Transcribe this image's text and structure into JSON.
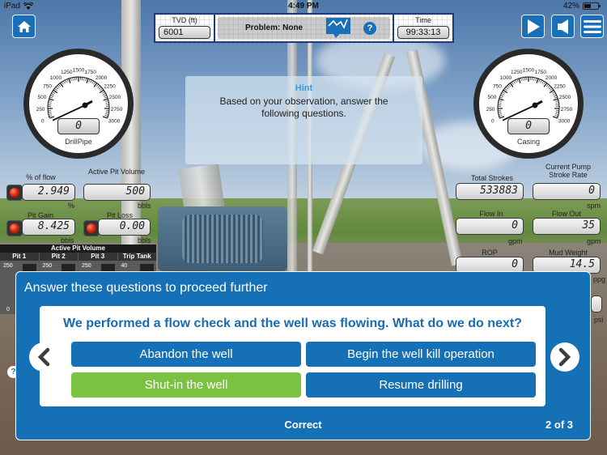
{
  "status_bar": {
    "device": "iPad",
    "time": "4:49 PM",
    "battery": "42%"
  },
  "toolbar": {
    "home_icon": "home-icon",
    "play_icon": "play-icon",
    "sound_icon": "speaker-icon",
    "menu_icon": "hamburger-menu-icon"
  },
  "top_panel": {
    "tvd_label": "TVD (ft)",
    "tvd_value": "6001",
    "problem_text": "Problem: None",
    "chart_icon": "chart-icon",
    "help_label": "?",
    "time_label": "Time",
    "time_value": "99:33:13"
  },
  "gauges": {
    "drillpipe": {
      "name": "DrillPipe",
      "value": "0",
      "scale_labels": [
        "0",
        "250",
        "500",
        "750",
        "1000",
        "1250",
        "1500",
        "1750",
        "2000",
        "2250",
        "2500",
        "2750",
        "3000"
      ]
    },
    "casing": {
      "name": "Casing",
      "value": "0",
      "scale_labels": [
        "0",
        "250",
        "500",
        "750",
        "1000",
        "1250",
        "1500",
        "1750",
        "2000",
        "2250",
        "2500",
        "2750",
        "3000"
      ]
    }
  },
  "hint": {
    "title": "Hint",
    "body": "Based on your observation, answer the following questions."
  },
  "left_readouts": {
    "pct_flow": {
      "label": "% of flow",
      "value": "2.949",
      "unit": "%"
    },
    "active_pit_volume": {
      "label": "Active Pit Volume",
      "value": "500",
      "unit": "bbls"
    },
    "pit_gain": {
      "label": "Pit Gain",
      "value": "8.425",
      "unit": "bbls"
    },
    "pit_loss": {
      "label": "Pit Loss",
      "value": "0.00",
      "unit": "bbls"
    }
  },
  "right_readouts": {
    "total_strokes": {
      "label": "Total Strokes",
      "value": "533883",
      "unit": ""
    },
    "pump_stroke_rate": {
      "label": "Current Pump Stroke Rate",
      "value": "0",
      "unit": "spm"
    },
    "flow_in": {
      "label": "Flow In",
      "value": "0",
      "unit": "gpm"
    },
    "flow_out": {
      "label": "Flow Out",
      "value": "35",
      "unit": "gpm"
    },
    "rop": {
      "label": "ROP",
      "value": "0",
      "unit": ""
    },
    "mud_weight": {
      "label": "Mud Weight",
      "value": "14.5",
      "unit": "ppg"
    },
    "extra_unit": "psi"
  },
  "pit_volume_panel": {
    "title": "Active Pit Volume",
    "pits": [
      {
        "name": "Pit 1",
        "max": "250",
        "min": "0"
      },
      {
        "name": "Pit 2",
        "max": "250",
        "min": ""
      },
      {
        "name": "Pit 3",
        "max": "250",
        "min": ""
      },
      {
        "name": "Trip Tank",
        "max": "40",
        "min": ""
      }
    ]
  },
  "quiz": {
    "title": "Answer these questions to proceed further",
    "question": "We performed a flow check and the well was flowing. What do we do next?",
    "answers": [
      {
        "label": "Abandon the well",
        "state": "default"
      },
      {
        "label": "Begin the well kill operation",
        "state": "default"
      },
      {
        "label": "Shut-in the well",
        "state": "correct"
      },
      {
        "label": "Resume drilling",
        "state": "default"
      }
    ],
    "status": "Correct",
    "page": "2 of 3",
    "prev_icon": "chevron-left-icon",
    "next_icon": "chevron-right-icon"
  },
  "colors": {
    "brand_blue": "#1670b5",
    "correct_green": "#7cc242",
    "hint_title": "#3a9ad9",
    "panel_border": "#1f3a80"
  },
  "small_help": "?"
}
